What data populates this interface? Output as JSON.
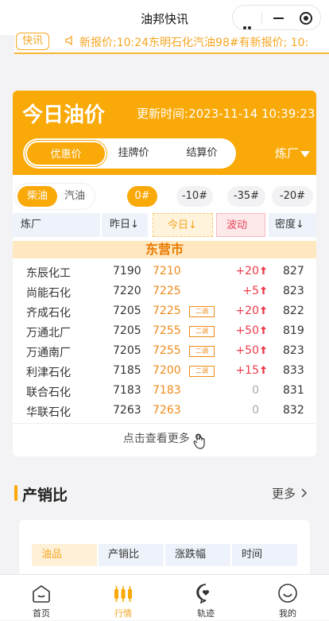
{
  "app": {
    "title": "油邦快讯"
  },
  "news": {
    "tag": "快讯",
    "text": "新报价;10:24东明石化汽油98#有新报价; 10:"
  },
  "price_card": {
    "title": "今日油价",
    "update_label": "更新时间:",
    "update_time": "2023-11-14 10:39:23",
    "tabs": [
      "优惠价",
      "挂牌价",
      "结算价"
    ],
    "active_tab": "优惠价",
    "refinery_filter": "炼厂",
    "fuel_types": [
      "柴油",
      "汽油"
    ],
    "active_fuel": "柴油",
    "grades": [
      "0#",
      "-10#",
      "-35#",
      "-20#"
    ],
    "active_grade": "0#",
    "columns": {
      "refinery": "炼厂",
      "yesterday": "昨日↓",
      "today": "今日↓",
      "change": "波动",
      "density": "密度↓"
    },
    "city": "东营市",
    "rows": [
      {
        "name": "东辰化工",
        "yesterday": "7190",
        "today": "7210",
        "tag": "",
        "change": "+20",
        "trend": "up",
        "density": "827"
      },
      {
        "name": "尚能石化",
        "yesterday": "7220",
        "today": "7225",
        "tag": "",
        "change": "+5",
        "trend": "up",
        "density": "823"
      },
      {
        "name": "齐成石化",
        "yesterday": "7205",
        "today": "7225",
        "tag": "二调",
        "change": "+20",
        "trend": "up",
        "density": "822"
      },
      {
        "name": "万通北厂",
        "yesterday": "7205",
        "today": "7255",
        "tag": "二调",
        "change": "+50",
        "trend": "up",
        "density": "819"
      },
      {
        "name": "万通南厂",
        "yesterday": "7205",
        "today": "7255",
        "tag": "二调",
        "change": "+50",
        "trend": "up",
        "density": "823"
      },
      {
        "name": "利津石化",
        "yesterday": "7185",
        "today": "7200",
        "tag": "二调",
        "change": "+15",
        "trend": "up",
        "density": "833"
      },
      {
        "name": "联合石化",
        "yesterday": "7183",
        "today": "7183",
        "tag": "",
        "change": "0",
        "trend": "flat",
        "density": "831"
      },
      {
        "name": "华联石化",
        "yesterday": "7263",
        "today": "7263",
        "tag": "",
        "change": "0",
        "trend": "flat",
        "density": "832"
      }
    ],
    "more_text": "点击查看更多"
  },
  "section_ratio": {
    "title": "产销比",
    "more": "更多",
    "columns": [
      "油品",
      "产销比",
      "涨跌幅",
      "时间"
    ]
  },
  "bottom_nav": [
    {
      "label": "首页",
      "icon": "home-icon"
    },
    {
      "label": "行情",
      "icon": "candlestick-icon"
    },
    {
      "label": "轨迹",
      "icon": "chat-heart-icon"
    },
    {
      "label": "我的",
      "icon": "smile-face-icon"
    }
  ],
  "colors": {
    "accent": "#f9a908",
    "up": "#ef3a4a",
    "today": "#ef8a1b"
  }
}
